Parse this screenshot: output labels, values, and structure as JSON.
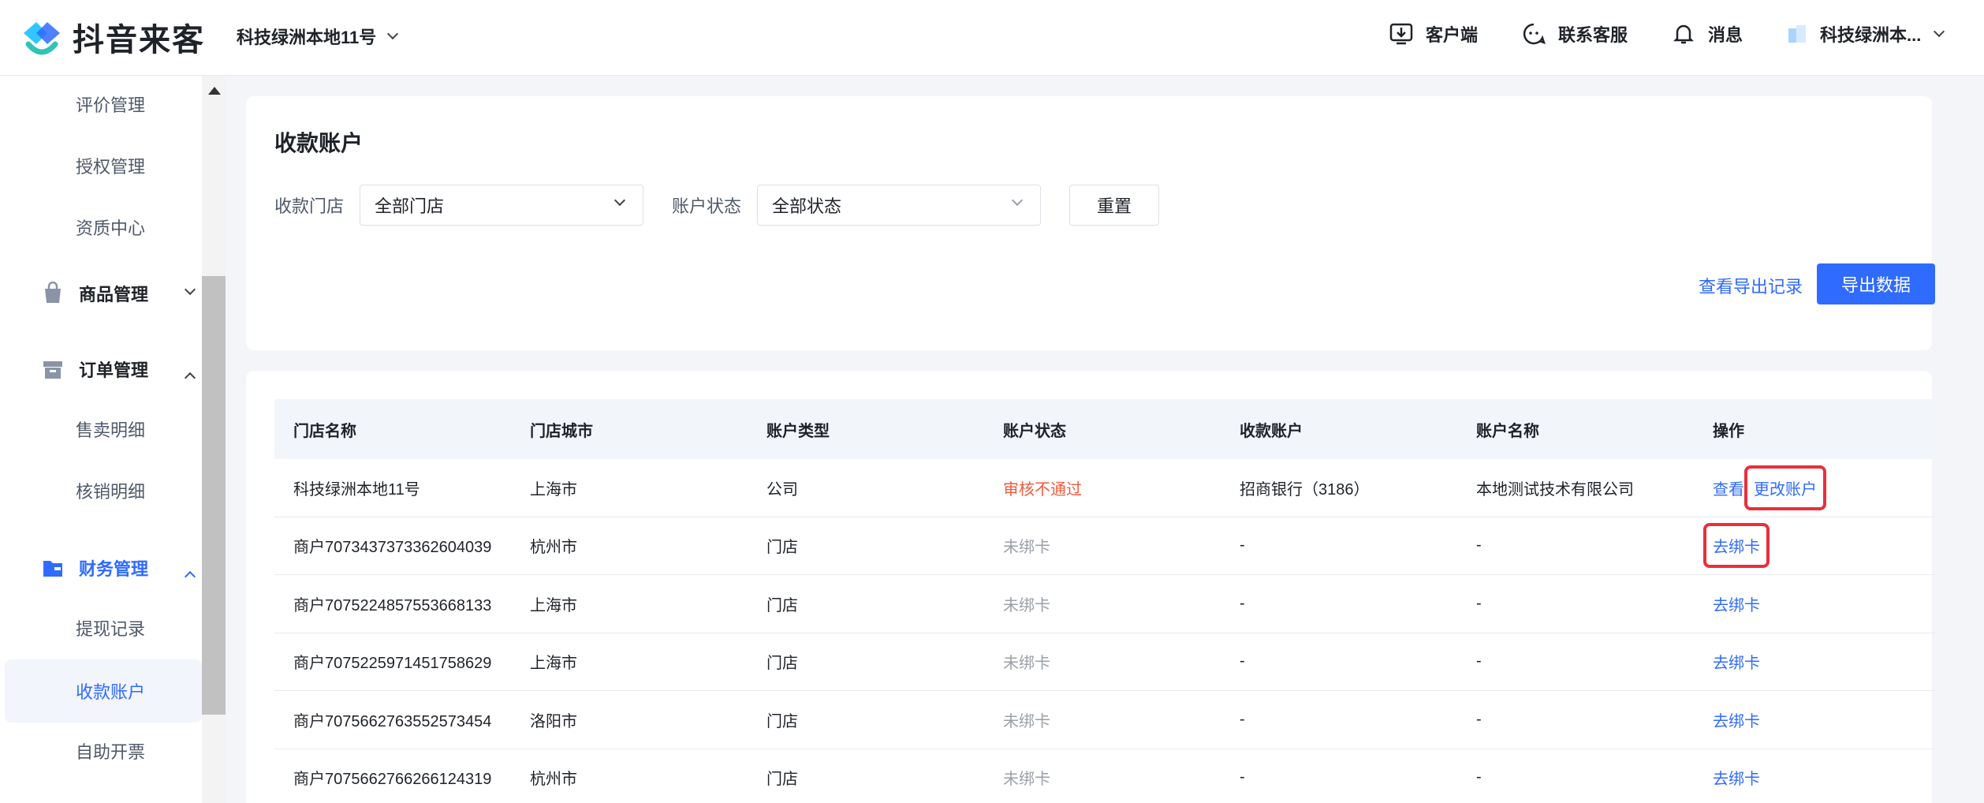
{
  "brand": {
    "name": "抖音来客"
  },
  "header": {
    "store_name": "科技绿洲本地11号",
    "actions": [
      {
        "label": "客户端",
        "icon": "download-icon"
      },
      {
        "label": "联系客服",
        "icon": "customer-service-icon"
      },
      {
        "label": "消息",
        "icon": "bell-icon"
      }
    ],
    "user_name": "科技绿洲本..."
  },
  "sidebar": {
    "items": [
      {
        "label": "评价管理",
        "type": "sub"
      },
      {
        "label": "授权管理",
        "type": "sub"
      },
      {
        "label": "资质中心",
        "type": "sub"
      },
      {
        "label": "商品管理",
        "type": "group",
        "icon": "shopping-bag-icon",
        "expanded": false
      },
      {
        "label": "订单管理",
        "type": "group",
        "icon": "box-icon",
        "expanded": true
      },
      {
        "label": "售卖明细",
        "type": "sub"
      },
      {
        "label": "核销明细",
        "type": "sub"
      },
      {
        "label": "财务管理",
        "type": "group",
        "icon": "folder-icon",
        "expanded": true,
        "highlight": true
      },
      {
        "label": "提现记录",
        "type": "sub"
      },
      {
        "label": "收款账户",
        "type": "sub",
        "active": true
      },
      {
        "label": "自助开票",
        "type": "sub"
      }
    ]
  },
  "page": {
    "title": "收款账户",
    "filters": {
      "store_label": "收款门店",
      "store_value": "全部门店",
      "status_label": "账户状态",
      "status_value": "全部状态",
      "reset_label": "重置"
    },
    "export_log_label": "查看导出记录",
    "export_label": "导出数据"
  },
  "table": {
    "columns": [
      "门店名称",
      "门店城市",
      "账户类型",
      "账户状态",
      "收款账户",
      "账户名称",
      "操作"
    ],
    "rows": [
      {
        "store": "科技绿洲本地11号",
        "city": "上海市",
        "type": "公司",
        "status": "审核不通过",
        "account": "招商银行（3186）",
        "name": "本地测试技术有限公司",
        "actions": [
          "查看",
          "更改账户"
        ]
      },
      {
        "store": "商户7073437373362604039",
        "city": "杭州市",
        "type": "门店",
        "status": "未绑卡",
        "account": "-",
        "name": "-",
        "actions": [
          "去绑卡"
        ]
      },
      {
        "store": "商户7075224857553668133",
        "city": "上海市",
        "type": "门店",
        "status": "未绑卡",
        "account": "-",
        "name": "-",
        "actions": [
          "去绑卡"
        ]
      },
      {
        "store": "商户7075225971451758629",
        "city": "上海市",
        "type": "门店",
        "status": "未绑卡",
        "account": "-",
        "name": "-",
        "actions": [
          "去绑卡"
        ]
      },
      {
        "store": "商户7075662763552573454",
        "city": "洛阳市",
        "type": "门店",
        "status": "未绑卡",
        "account": "-",
        "name": "-",
        "actions": [
          "去绑卡"
        ]
      },
      {
        "store": "商户7075662766266124319",
        "city": "杭州市",
        "type": "门店",
        "status": "未绑卡",
        "account": "-",
        "name": "-",
        "actions": [
          "去绑卡"
        ]
      }
    ]
  },
  "colors": {
    "primary": "#2f6bff",
    "danger": "#f05a3c",
    "highlight_box": "#e8303a"
  }
}
